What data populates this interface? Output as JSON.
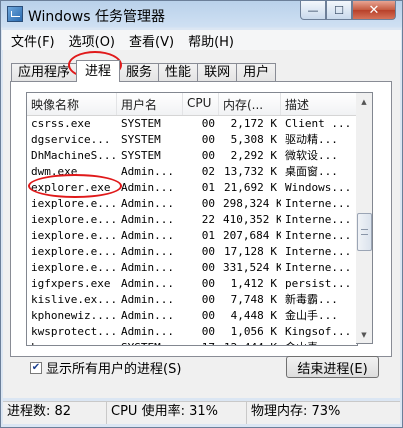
{
  "window": {
    "title": "Windows 任务管理器",
    "minimize_label": "—",
    "maximize_label": "☐",
    "close_label": "✕"
  },
  "menu": [
    "文件(F)",
    "选项(O)",
    "查看(V)",
    "帮助(H)"
  ],
  "tabs": [
    "应用程序",
    "进程",
    "服务",
    "性能",
    "联网",
    "用户"
  ],
  "active_tab": "进程",
  "columns": [
    "映像名称",
    "用户名",
    "CPU",
    "内存(...",
    "描述"
  ],
  "rows": [
    [
      "csrss.exe",
      "SYSTEM",
      "00",
      "2,172 K",
      "Client ..."
    ],
    [
      "dgservice...",
      "SYSTEM",
      "00",
      "5,308 K",
      "驱动精..."
    ],
    [
      "DhMachineS...",
      "SYSTEM",
      "00",
      "2,292 K",
      "微软设..."
    ],
    [
      "dwm.exe",
      "Admin...",
      "02",
      "13,732 K",
      "桌面窗..."
    ],
    [
      "explorer.exe",
      "Admin...",
      "01",
      "21,692 K",
      "Windows..."
    ],
    [
      "iexplore.e...",
      "Admin...",
      "00",
      "298,324 K",
      "Interne..."
    ],
    [
      "iexplore.e...",
      "Admin...",
      "22",
      "410,352 K",
      "Interne..."
    ],
    [
      "iexplore.e...",
      "Admin...",
      "01",
      "207,684 K",
      "Interne..."
    ],
    [
      "iexplore.e...",
      "Admin...",
      "00",
      "17,128 K",
      "Interne..."
    ],
    [
      "iexplore.e...",
      "Admin...",
      "00",
      "331,524 K",
      "Interne..."
    ],
    [
      "igfxpers.exe",
      "Admin...",
      "00",
      "1,412 K",
      "persist..."
    ],
    [
      "kislive.ex...",
      "Admin...",
      "00",
      "7,748 K",
      "新毒霸..."
    ],
    [
      "kphonewiz....",
      "Admin...",
      "00",
      "4,448 K",
      "金山手..."
    ],
    [
      "kwsprotect...",
      "Admin...",
      "00",
      "1,056 K",
      "Kingsof..."
    ],
    [
      "kxescore.exe",
      "SYSTEM",
      "17",
      "12,444 K",
      "金山毒..."
    ]
  ],
  "show_all_checkbox": {
    "label": "显示所有用户的进程(S)",
    "checked": true
  },
  "end_process_button": "结束进程(E)",
  "status": {
    "processes": "进程数: 82",
    "cpu": "CPU 使用率: 31%",
    "memory": "物理内存: 73%"
  },
  "colors": {
    "annotation": "#e0191a",
    "titlebar": "#b9d1ea"
  }
}
